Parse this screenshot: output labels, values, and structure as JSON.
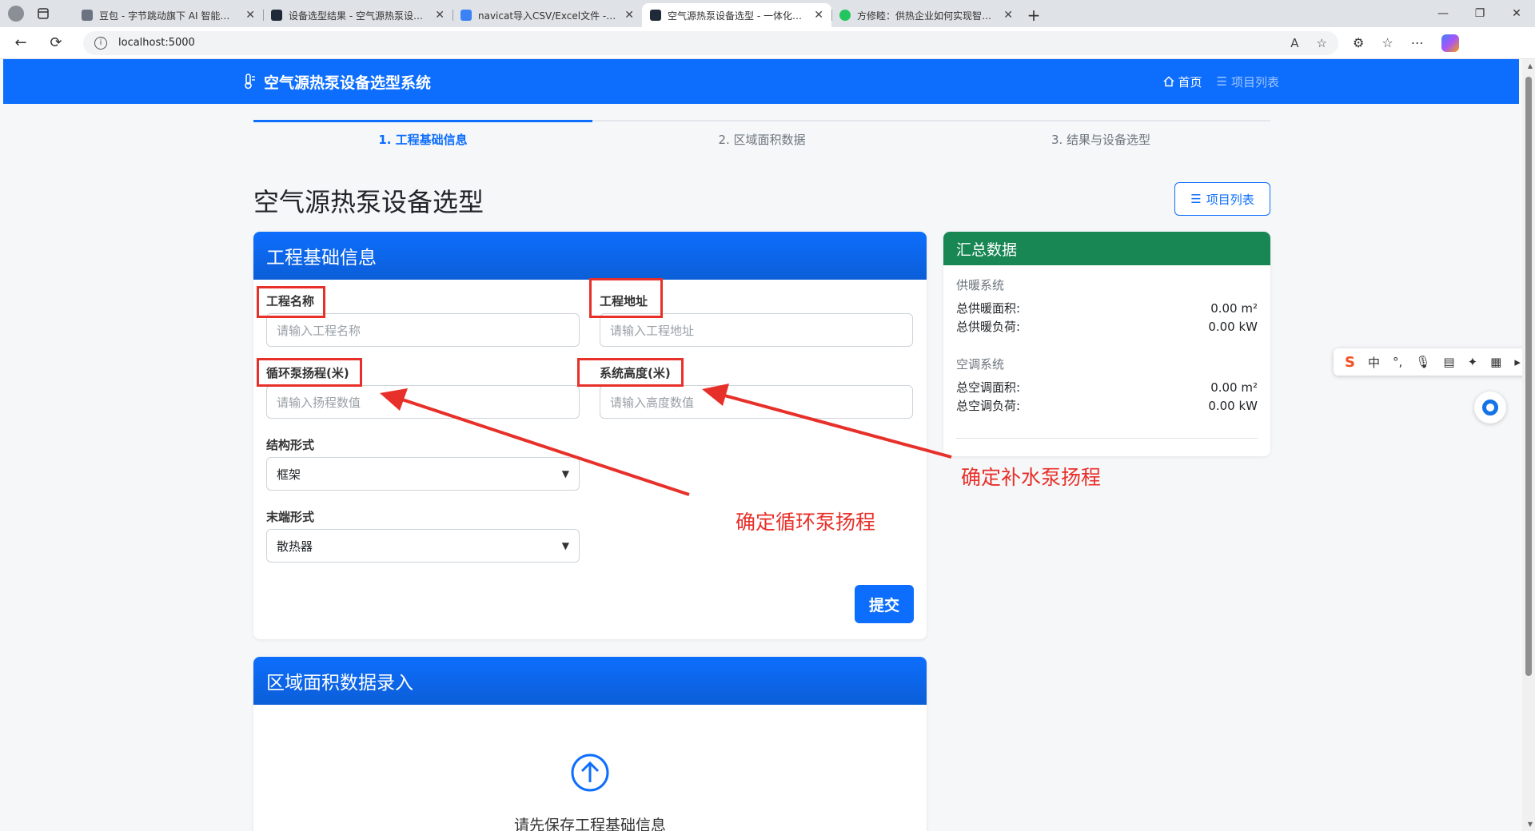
{
  "browser": {
    "tabs": [
      {
        "title": "豆包 - 字节跳动旗下 AI 智能助手",
        "fav_color": "#6b7280",
        "active": false
      },
      {
        "title": "设备选型结果 - 空气源热泵设备选型",
        "fav_color": "#1f2937",
        "active": false
      },
      {
        "title": "navicat导入CSV/Excel文件 - 知乎",
        "fav_color": "#3b82f6",
        "active": false
      },
      {
        "title": "空气源热泵设备选型 - 一体化数据",
        "fav_color": "#1f2937",
        "active": true
      },
      {
        "title": "方修睦：供热企业如何实现智慧化",
        "fav_color": "#22c55e",
        "active": false
      }
    ],
    "url": "localhost:5000"
  },
  "navbar": {
    "brand": "空气源热泵设备选型系统",
    "home": "首页",
    "projects": "项目列表"
  },
  "steps": [
    {
      "label": "1. 工程基础信息",
      "active": true
    },
    {
      "label": "2. 区域面积数据",
      "active": false
    },
    {
      "label": "3. 结果与设备选型",
      "active": false
    }
  ],
  "page": {
    "title": "空气源热泵设备选型",
    "project_list_btn": "项目列表"
  },
  "form": {
    "header": "工程基础信息",
    "name_label": "工程名称",
    "name_placeholder": "请输入工程名称",
    "address_label": "工程地址",
    "address_placeholder": "请输入工程地址",
    "pump_head_label": "循环泵扬程(米)",
    "pump_head_placeholder": "请输入扬程数值",
    "height_label": "系统高度(米)",
    "height_placeholder": "请输入高度数值",
    "structure_label": "结构形式",
    "structure_value": "框架",
    "terminal_label": "末端形式",
    "terminal_value": "散热器",
    "submit": "提交"
  },
  "summary": {
    "header": "汇总数据",
    "heating_section": "供暖系统",
    "heating_area_label": "总供暖面积:",
    "heating_area_value": "0.00 m²",
    "heating_load_label": "总供暖负荷:",
    "heating_load_value": "0.00 kW",
    "ac_section": "空调系统",
    "ac_area_label": "总空调面积:",
    "ac_area_value": "0.00 m²",
    "ac_load_label": "总空调负荷:",
    "ac_load_value": "0.00 kW"
  },
  "area": {
    "header": "区域面积数据录入",
    "message": "请先保存工程基础信息"
  },
  "annotations": {
    "circ_pump": "确定循环泵扬程",
    "makeup_pump": "确定补水泵扬程",
    "color": "#e8302a"
  },
  "ime": {
    "chinese": "中"
  },
  "colors": {
    "primary": "#0d6efd",
    "success": "#198754"
  }
}
